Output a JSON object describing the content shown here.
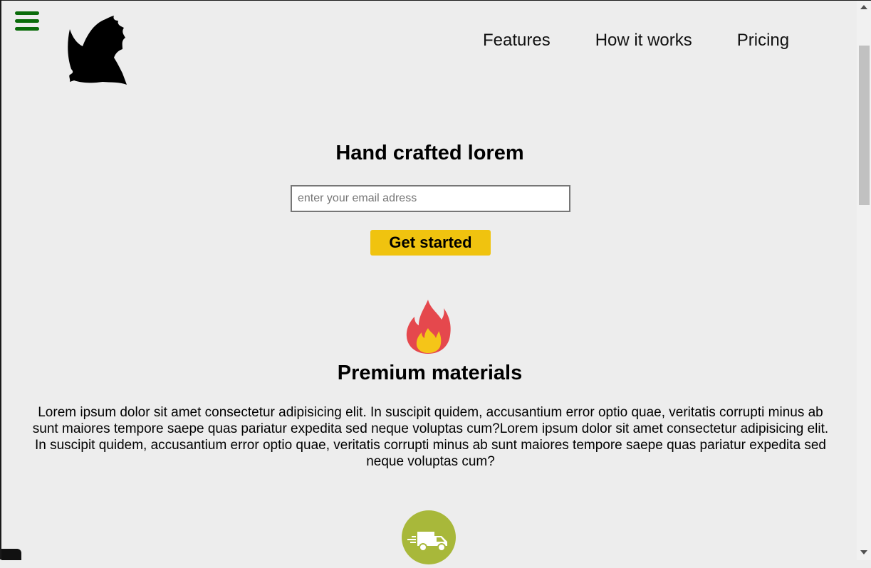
{
  "header": {
    "menu_icon": "hamburger-menu-icon",
    "logo_icon": "eagle-silhouette-icon",
    "nav": [
      {
        "label": "Features"
      },
      {
        "label": "How it works"
      },
      {
        "label": "Pricing"
      }
    ]
  },
  "hero": {
    "title": "Hand crafted lorem",
    "email_placeholder": "enter your email adress",
    "email_value": "",
    "cta_label": "Get started"
  },
  "features": [
    {
      "icon": "fire-icon",
      "title": "Premium materials",
      "text": "Lorem ipsum dolor sit amet consectetur adipisicing elit. In suscipit quidem, accusantium error optio quae, veritatis corrupti minus ab sunt maiores tempore saepe quas pariatur expedita sed neque voluptas cum?Lorem ipsum dolor sit amet consectetur adipisicing elit. In suscipit quidem, accusantium error optio quae, veritatis corrupti minus ab sunt maiores tempore saepe quas pariatur expedita sed neque voluptas cum?"
    },
    {
      "icon": "delivery-truck-icon"
    }
  ],
  "colors": {
    "background": "#ededed",
    "menu_icon": "#0a6b0a",
    "cta_button": "#f0c30f",
    "truck_badge": "#a8b83a",
    "fire_outer": "#e5484d",
    "fire_inner": "#f5c518"
  }
}
